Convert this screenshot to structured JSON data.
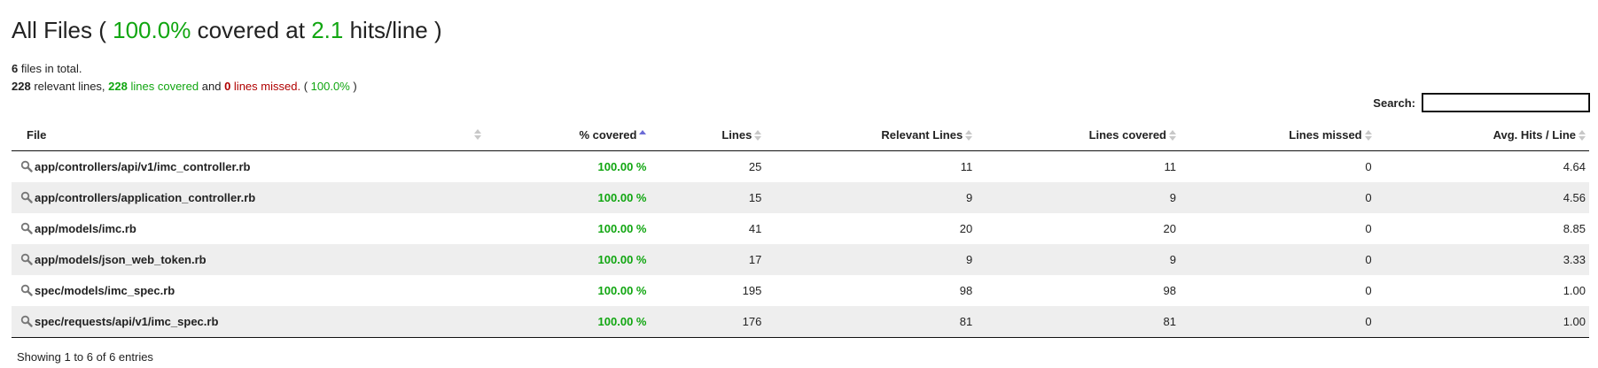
{
  "header": {
    "prefix": "All Files (",
    "percent": "100.0%",
    "middle": "covered at",
    "hits": "2.1",
    "suffix": "hits/line )"
  },
  "summary": {
    "files_count": "6",
    "files_text": "files in total.",
    "relevant": "228",
    "relevant_text": "relevant lines,",
    "covered": "228",
    "covered_text": "lines covered",
    "and_text": "and",
    "missed": "0",
    "missed_text": "lines missed.",
    "paren_open": "(",
    "percent": "100.0%",
    "paren_close": ")"
  },
  "search": {
    "label": "Search:",
    "value": ""
  },
  "columns": {
    "file": "File",
    "covered": "% covered",
    "lines": "Lines",
    "relevant": "Relevant Lines",
    "lines_covered": "Lines covered",
    "lines_missed": "Lines missed",
    "avg_hits": "Avg. Hits / Line"
  },
  "rows": [
    {
      "file": "app/controllers/api/v1/imc_controller.rb",
      "covered": "100.00 %",
      "lines": "25",
      "relevant": "11",
      "lines_covered": "11",
      "lines_missed": "0",
      "avg_hits": "4.64"
    },
    {
      "file": "app/controllers/application_controller.rb",
      "covered": "100.00 %",
      "lines": "15",
      "relevant": "9",
      "lines_covered": "9",
      "lines_missed": "0",
      "avg_hits": "4.56"
    },
    {
      "file": "app/models/imc.rb",
      "covered": "100.00 %",
      "lines": "41",
      "relevant": "20",
      "lines_covered": "20",
      "lines_missed": "0",
      "avg_hits": "8.85"
    },
    {
      "file": "app/models/json_web_token.rb",
      "covered": "100.00 %",
      "lines": "17",
      "relevant": "9",
      "lines_covered": "9",
      "lines_missed": "0",
      "avg_hits": "3.33"
    },
    {
      "file": "spec/models/imc_spec.rb",
      "covered": "100.00 %",
      "lines": "195",
      "relevant": "98",
      "lines_covered": "98",
      "lines_missed": "0",
      "avg_hits": "1.00"
    },
    {
      "file": "spec/requests/api/v1/imc_spec.rb",
      "covered": "100.00 %",
      "lines": "176",
      "relevant": "81",
      "lines_covered": "81",
      "lines_missed": "0",
      "avg_hits": "1.00"
    }
  ],
  "footer": {
    "info": "Showing 1 to 6 of 6 entries"
  },
  "colors": {
    "covered_green": "#11a611",
    "missed_red": "#b00000",
    "sort_active": "#6b6bd6"
  },
  "icons": {
    "row_icon": "magnifier-icon"
  }
}
